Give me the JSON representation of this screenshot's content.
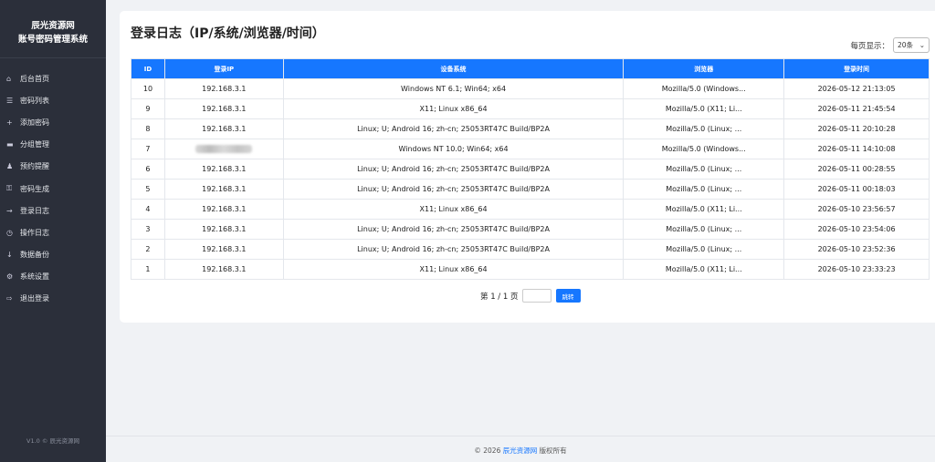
{
  "sidebar": {
    "brand_line1": "辰光资源网",
    "brand_line2": "账号密码管理系统",
    "items": [
      {
        "label": "后台首页",
        "icon": "⌂"
      },
      {
        "label": "密码列表",
        "icon": "☰"
      },
      {
        "label": "添加密码",
        "icon": "+"
      },
      {
        "label": "分组管理",
        "icon": "▬"
      },
      {
        "label": "预约提醒",
        "icon": "♟"
      },
      {
        "label": "密码生成",
        "icon": "⚿"
      },
      {
        "label": "登录日志",
        "icon": "→"
      },
      {
        "label": "操作日志",
        "icon": "◷"
      },
      {
        "label": "数据备份",
        "icon": "↓"
      },
      {
        "label": "系统设置",
        "icon": "⚙"
      },
      {
        "label": "退出登录",
        "icon": "⇨"
      }
    ],
    "version": "V1.0 © 辰光资源网"
  },
  "main": {
    "title": "登录日志（IP/系统/浏览器/时间）",
    "per_page_label": "每页显示：",
    "per_page_value": "20条",
    "columns": [
      "ID",
      "登录IP",
      "设备系统",
      "浏览器",
      "登录时间"
    ],
    "rows": [
      {
        "id": "10",
        "ip": "192.168.3.1",
        "os": "Windows NT 6.1; Win64; x64",
        "browser": "Mozilla/5.0 (Windows...",
        "time": "2026-05-12 21:13:05"
      },
      {
        "id": "9",
        "ip": "192.168.3.1",
        "os": "X11; Linux x86_64",
        "browser": "Mozilla/5.0 (X11; Li...",
        "time": "2026-05-11 21:45:54"
      },
      {
        "id": "8",
        "ip": "192.168.3.1",
        "os": "Linux; U; Android 16; zh-cn; 25053RT47C Build/BP2A",
        "browser": "Mozilla/5.0 (Linux; ...",
        "time": "2026-05-11 20:10:28"
      },
      {
        "id": "7",
        "ip": "",
        "os": "Windows NT 10.0; Win64; x64",
        "browser": "Mozilla/5.0 (Windows...",
        "time": "2026-05-11 14:10:08"
      },
      {
        "id": "6",
        "ip": "192.168.3.1",
        "os": "Linux; U; Android 16; zh-cn; 25053RT47C Build/BP2A",
        "browser": "Mozilla/5.0 (Linux; ...",
        "time": "2026-05-11 00:28:55"
      },
      {
        "id": "5",
        "ip": "192.168.3.1",
        "os": "Linux; U; Android 16; zh-cn; 25053RT47C Build/BP2A",
        "browser": "Mozilla/5.0 (Linux; ...",
        "time": "2026-05-11 00:18:03"
      },
      {
        "id": "4",
        "ip": "192.168.3.1",
        "os": "X11; Linux x86_64",
        "browser": "Mozilla/5.0 (X11; Li...",
        "time": "2026-05-10 23:56:57"
      },
      {
        "id": "3",
        "ip": "192.168.3.1",
        "os": "Linux; U; Android 16; zh-cn; 25053RT47C Build/BP2A",
        "browser": "Mozilla/5.0 (Linux; ...",
        "time": "2026-05-10 23:54:06"
      },
      {
        "id": "2",
        "ip": "192.168.3.1",
        "os": "Linux; U; Android 16; zh-cn; 25053RT47C Build/BP2A",
        "browser": "Mozilla/5.0 (Linux; ...",
        "time": "2026-05-10 23:52:36"
      },
      {
        "id": "1",
        "ip": "192.168.3.1",
        "os": "X11; Linux x86_64",
        "browser": "Mozilla/5.0 (X11; Li...",
        "time": "2026-05-10 23:33:23"
      }
    ],
    "pager_text": "第 1 / 1 页",
    "go_label": "跳转"
  },
  "footer": {
    "prefix": "© 2026 ",
    "link": "辰光资源网",
    "suffix": " 版权所有"
  },
  "colors": {
    "accent": "#1677ff",
    "sidebar_bg": "#2b2f3a"
  }
}
